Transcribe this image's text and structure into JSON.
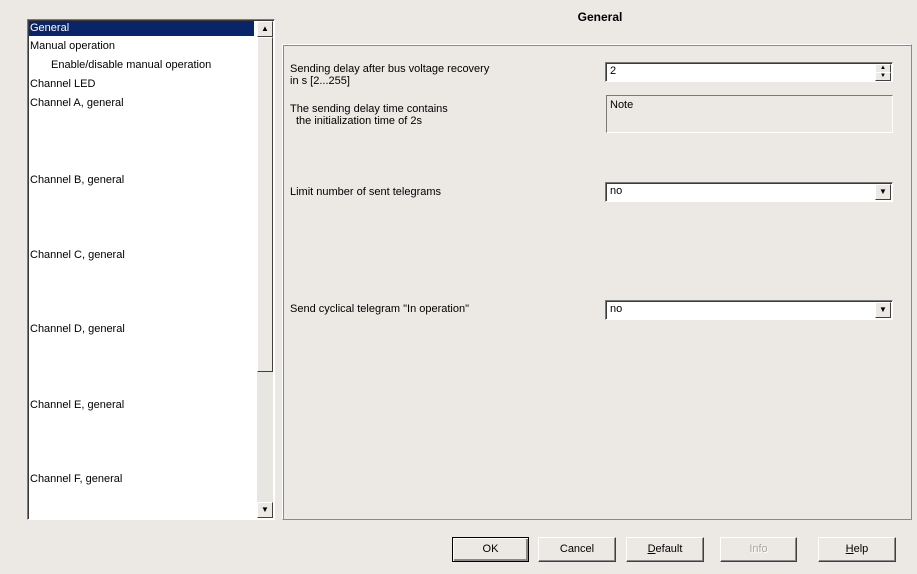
{
  "tree": {
    "items": [
      {
        "label": "General",
        "selected": true
      },
      {
        "label": "Manual operation"
      },
      {
        "label": "Enable/disable manual operation",
        "indent": true
      },
      {
        "label": "Channel LED"
      },
      {
        "label": "Channel A, general"
      },
      {
        "label": "Channel B, general"
      },
      {
        "label": "Channel C, general"
      },
      {
        "label": "Channel D, general"
      },
      {
        "label": "Channel E, general"
      },
      {
        "label": "Channel F, general"
      }
    ],
    "scroll_up_icon": "▲",
    "scroll_down_icon": "▼"
  },
  "panel": {
    "title": "General",
    "sending_delay": {
      "label_line1": "Sending delay after bus voltage recovery",
      "label_line2": "in s [2...255]",
      "value": "2"
    },
    "note": {
      "label_line1": "The sending delay time contains",
      "label_line2": "the initialization time of 2s",
      "value": "Note"
    },
    "limit_telegrams": {
      "label": "Limit number of sent telegrams",
      "value": "no"
    },
    "cyclical_telegram": {
      "label": "Send cyclical telegram \"In operation\"",
      "value": "no"
    }
  },
  "buttons": {
    "ok": "OK",
    "cancel": "Cancel",
    "default_first": "D",
    "default_rest": "efault",
    "info": "Info",
    "help_first": "H",
    "help_rest": "elp"
  }
}
